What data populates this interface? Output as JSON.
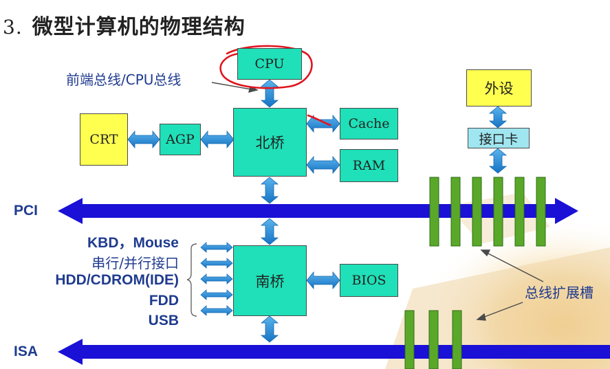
{
  "title": {
    "number": "3.",
    "text": "微型计算机的物理结构"
  },
  "components": {
    "cpu": "CPU",
    "north_bridge": "北桥",
    "cache": "Cache",
    "ram": "RAM",
    "crt": "CRT",
    "agp": "AGP",
    "south_bridge": "南桥",
    "bios": "BIOS",
    "peripheral": "外设",
    "interface_card": "接口卡"
  },
  "labels": {
    "fsb": "前端总线/CPU总线",
    "pci": "PCI",
    "isa": "ISA",
    "kbd_mouse": "KBD，Mouse",
    "serial_parallel": "串行/并行接口",
    "hdd_cdrom": "HDD/CDROM(IDE)",
    "fdd": "FDD",
    "usb": "USB",
    "expansion_slots": "总线扩展槽"
  },
  "colors": {
    "teal_box": "#1fe0b8",
    "yellow_box": "#ffff50",
    "arrow_fill": "#1e8bd4",
    "bus_fill": "#1a10d6",
    "slot_green": "#5aa82a",
    "annotation_red": "#e0141e"
  }
}
